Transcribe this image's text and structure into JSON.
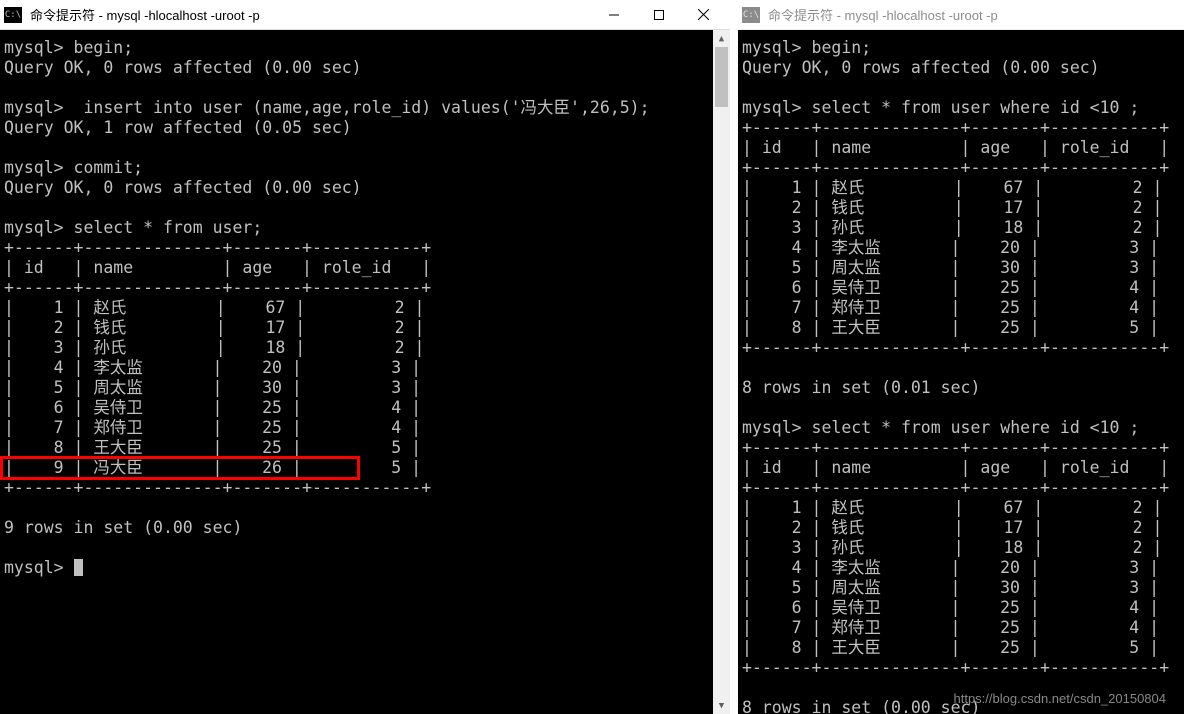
{
  "left": {
    "title": "命令提示符 - mysql  -hlocalhost -uroot -p",
    "commands": {
      "begin": "mysql> begin;",
      "begin_result": "Query OK, 0 rows affected (0.00 sec)",
      "insert": "mysql>  insert into user (name,age,role_id) values('冯大臣',26,5);",
      "insert_result": "Query OK, 1 row affected (0.05 sec)",
      "commit": "mysql> commit;",
      "commit_result": "Query OK, 0 rows affected (0.00 sec)",
      "select": "mysql> select * from user;",
      "footer": "9 rows in set (0.00 sec)",
      "prompt": "mysql> "
    },
    "headers": {
      "id": "id",
      "name": "name",
      "age": "age",
      "role_id": "role_id"
    },
    "rows": [
      {
        "id": "1",
        "name": "赵氏",
        "age": "67",
        "role_id": "2"
      },
      {
        "id": "2",
        "name": "钱氏",
        "age": "17",
        "role_id": "2"
      },
      {
        "id": "3",
        "name": "孙氏",
        "age": "18",
        "role_id": "2"
      },
      {
        "id": "4",
        "name": "李太监",
        "age": "20",
        "role_id": "3"
      },
      {
        "id": "5",
        "name": "周太监",
        "age": "30",
        "role_id": "3"
      },
      {
        "id": "6",
        "name": "吴侍卫",
        "age": "25",
        "role_id": "4"
      },
      {
        "id": "7",
        "name": "郑侍卫",
        "age": "25",
        "role_id": "4"
      },
      {
        "id": "8",
        "name": "王大臣",
        "age": "25",
        "role_id": "5"
      },
      {
        "id": "9",
        "name": "冯大臣",
        "age": "26",
        "role_id": "5"
      }
    ]
  },
  "right": {
    "title": "命令提示符 - mysql  -hlocalhost -uroot -p",
    "commands": {
      "begin": "mysql> begin;",
      "begin_result": "Query OK, 0 rows affected (0.00 sec)",
      "select1": "mysql> select * from user where id <10 ;",
      "footer1": "8 rows in set (0.01 sec)",
      "select2": "mysql> select * from user where id <10 ;",
      "footer2": "8 rows in set (0.00 sec)"
    },
    "headers": {
      "id": "id",
      "name": "name",
      "age": "age",
      "role_id": "role_id"
    },
    "rows": [
      {
        "id": "1",
        "name": "赵氏",
        "age": "67",
        "role_id": "2"
      },
      {
        "id": "2",
        "name": "钱氏",
        "age": "17",
        "role_id": "2"
      },
      {
        "id": "3",
        "name": "孙氏",
        "age": "18",
        "role_id": "2"
      },
      {
        "id": "4",
        "name": "李太监",
        "age": "20",
        "role_id": "3"
      },
      {
        "id": "5",
        "name": "周太监",
        "age": "30",
        "role_id": "3"
      },
      {
        "id": "6",
        "name": "吴侍卫",
        "age": "25",
        "role_id": "4"
      },
      {
        "id": "7",
        "name": "郑侍卫",
        "age": "25",
        "role_id": "4"
      },
      {
        "id": "8",
        "name": "王大臣",
        "age": "25",
        "role_id": "5"
      }
    ]
  },
  "watermark": "https://blog.csdn.net/csdn_20150804",
  "sep": "+----+--------+------+---------+"
}
